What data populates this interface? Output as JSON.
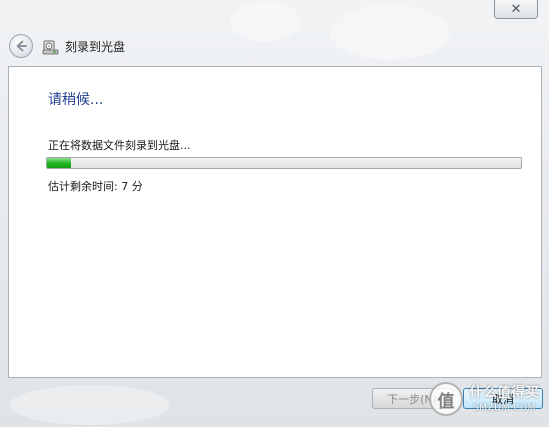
{
  "window": {
    "title": "刻录到光盘",
    "close_glyph": "✕",
    "back_icon": "back-arrow-icon",
    "title_icon": "disc-burner-icon"
  },
  "content": {
    "heading": "请稍候...",
    "status": "正在将数据文件刻录到光盘...",
    "progress_fraction": 0.05,
    "remaining": "估计剩余时间: 7 分"
  },
  "buttons": {
    "next_label": "下一步(N)",
    "next_enabled": false,
    "cancel_label": "取消"
  },
  "watermark": {
    "badge_char": "值",
    "line1": "什么值得买",
    "line2": "SMZDM.COM"
  },
  "colors": {
    "heading": "#1f3f8f",
    "progress_green": "#27b827",
    "cancel_border": "#3c7fb1"
  }
}
